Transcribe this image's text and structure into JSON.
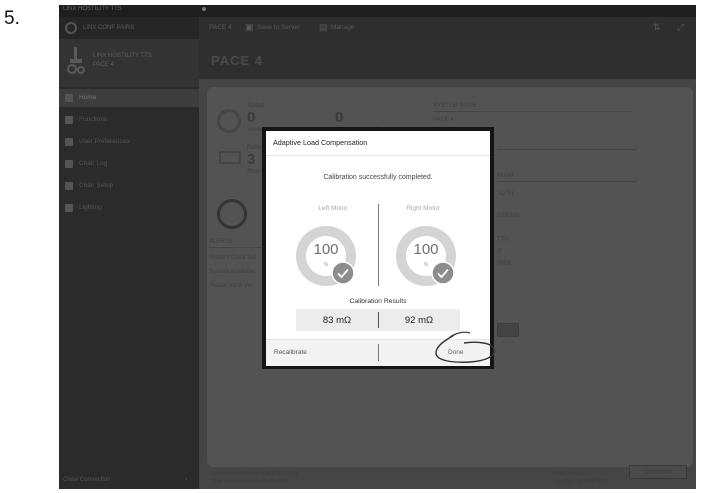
{
  "step_number": "5.",
  "window": {
    "app_title": "LINX HOSTILITY TTS"
  },
  "sidebar": {
    "device_text": "LINX CONF PAIRS",
    "chair_line1": "LINX HOSTILITY TTS",
    "chair_line2": "PACE 4",
    "items": [
      {
        "label": "Home",
        "icon": "home-icon",
        "active": true
      },
      {
        "label": "Functions",
        "icon": "functions-icon",
        "active": false
      },
      {
        "label": "User Preferences",
        "icon": "user-preferences-icon",
        "active": false
      },
      {
        "label": "Chair Log",
        "icon": "chair-log-icon",
        "active": false
      },
      {
        "label": "Chair Setup",
        "icon": "chair-setup-icon",
        "active": false
      },
      {
        "label": "Lighting",
        "icon": "lighting-icon",
        "active": false
      }
    ],
    "footer": "Close Connection"
  },
  "toolbar": {
    "chair": "PACE 4",
    "save": "Save to Server",
    "manage": "Manage"
  },
  "header": {
    "title": "PACE 4"
  },
  "background": {
    "speed_label": "Speed",
    "speed_value": "0",
    "speed_sub": "Seven driving",
    "second_value": "0",
    "second_sub": "Seven driving / Ber",
    "battery_label": "Battery Level",
    "battery_value": "3",
    "battery_sub": "Stop on",
    "system_label": "SYSTEM NAME",
    "system_value": "PACE 4",
    "right_labels": [
      "Model",
      "TOTH",
      "STRING",
      "TTH",
      "IF",
      "PWR"
    ],
    "alerts": "ALERTS",
    "rows": [
      "System Clock Set",
      "System Available",
      "Please Input Ver"
    ],
    "footer_left_1": "Connected to 4W rear PREPORT 2021",
    "footer_left_2": "Chair software version 04 04 0006",
    "footer_right_1": "LINX Certified",
    "footer_right_2": "Last Sync 04 14/04 2021",
    "footer_button": "Synchronize"
  },
  "modal": {
    "title": "Adaptive Load Compensation",
    "message": "Calibration successfully completed.",
    "left_motor": {
      "label": "Left Motor",
      "value": "100",
      "unit": "%",
      "progress": 1.0
    },
    "right_motor": {
      "label": "Right Motor",
      "value": "100",
      "unit": "%",
      "progress": 1.0
    },
    "results_title": "Calibration Results",
    "left_result": "83 mΩ",
    "right_result": "92 mΩ",
    "recalibrate": "Recalibrate",
    "done": "Done"
  },
  "colors": {
    "overlay": "#3a3a3a",
    "gauge_ring": "#d4d4d4",
    "check_badge": "#8d8d8d",
    "annotation": "#333333"
  }
}
